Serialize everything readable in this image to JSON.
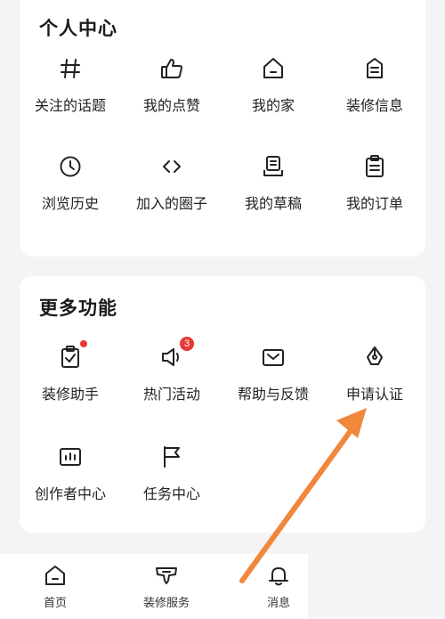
{
  "personal_center": {
    "title": "个人中心",
    "items": [
      {
        "label": "关注的话题",
        "icon": "hashtag-icon"
      },
      {
        "label": "我的点赞",
        "icon": "thumbs-up-icon"
      },
      {
        "label": "我的家",
        "icon": "home-icon"
      },
      {
        "label": "装修信息",
        "icon": "document-icon"
      },
      {
        "label": "浏览历史",
        "icon": "clock-icon"
      },
      {
        "label": "加入的圈子",
        "icon": "code-brackets-icon"
      },
      {
        "label": "我的草稿",
        "icon": "draft-box-icon"
      },
      {
        "label": "我的订单",
        "icon": "clipboard-icon"
      }
    ]
  },
  "more_features": {
    "title": "更多功能",
    "items": [
      {
        "label": "装修助手",
        "icon": "clipboard-check-icon",
        "badge_dot": true
      },
      {
        "label": "热门活动",
        "icon": "megaphone-icon",
        "badge_count": "3"
      },
      {
        "label": "帮助与反馈",
        "icon": "envelope-icon"
      },
      {
        "label": "申请认证",
        "icon": "pen-nib-icon"
      },
      {
        "label": "创作者中心",
        "icon": "chart-icon"
      },
      {
        "label": "任务中心",
        "icon": "flag-icon"
      }
    ]
  },
  "tab_bar": {
    "items": [
      {
        "label": "首页",
        "icon": "home-tab-icon"
      },
      {
        "label": "装修服务",
        "icon": "service-icon"
      },
      {
        "label": "消息",
        "icon": "bell-icon"
      }
    ]
  },
  "colors": {
    "background": "#f4f4f5",
    "card": "#ffffff",
    "badge": "#e53935",
    "annotation_arrow": "#f0873a"
  }
}
